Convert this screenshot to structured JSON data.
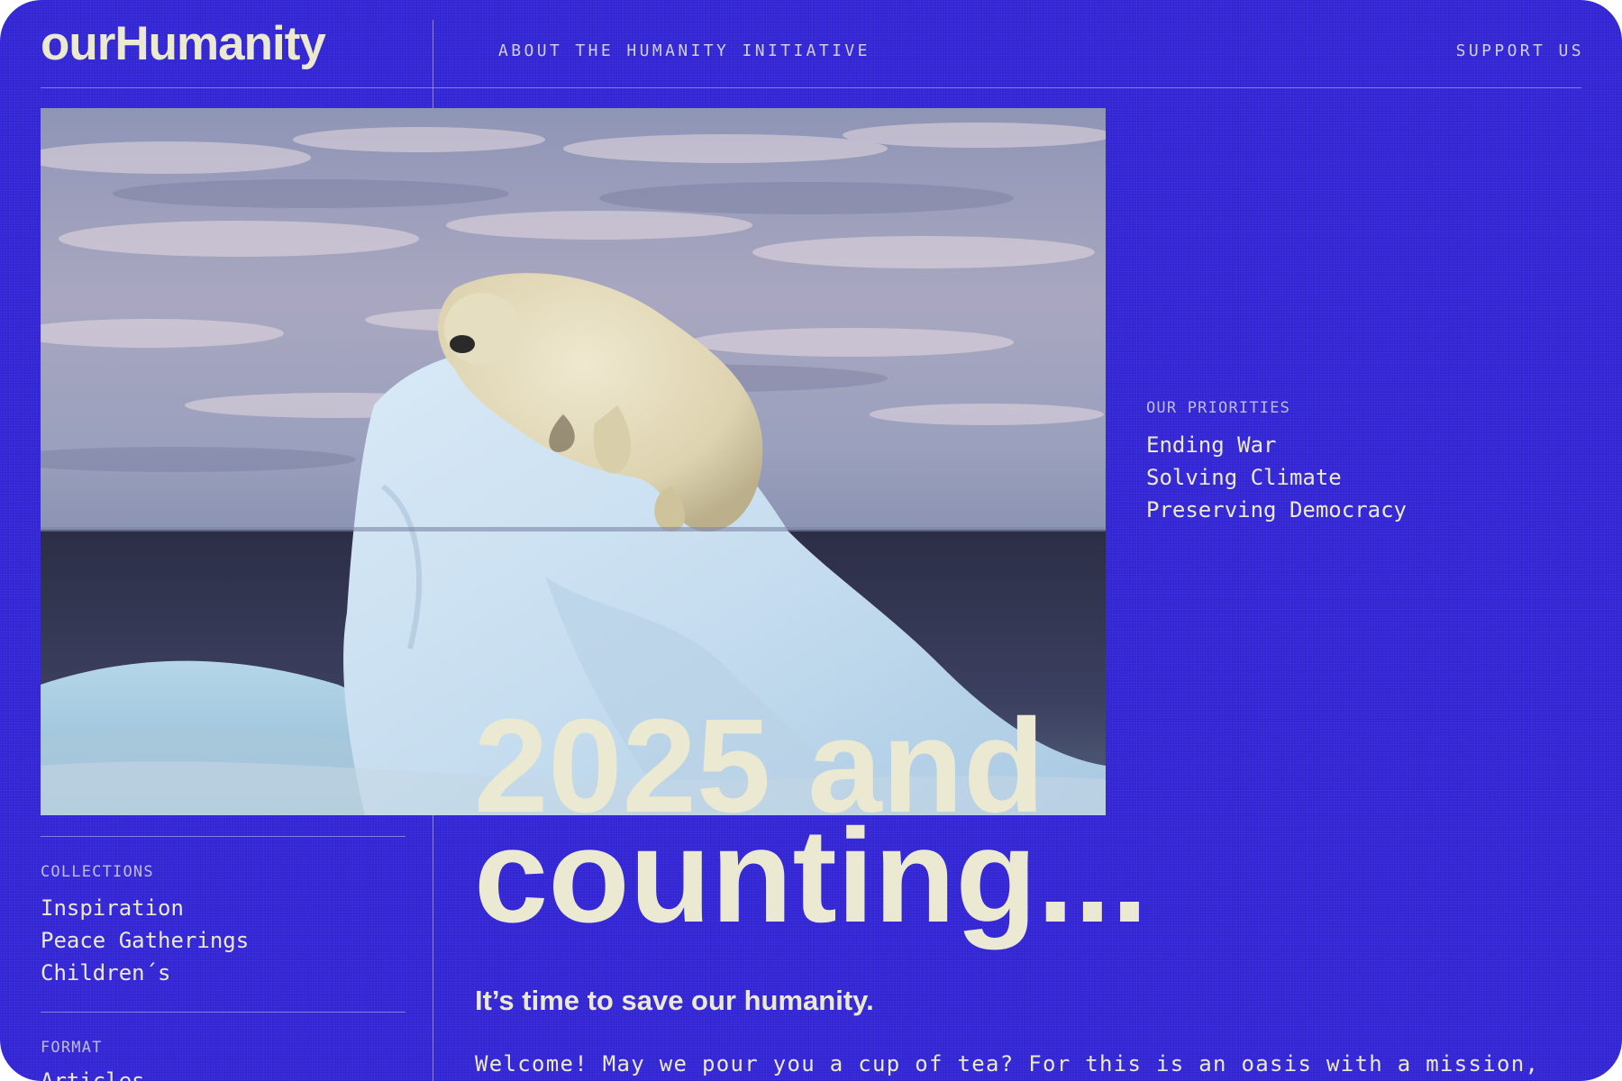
{
  "header": {
    "logo": "ourHumanity",
    "nav_about": "ABOUT THE HUMANITY INITIATIVE",
    "nav_support": "SUPPORT US"
  },
  "hero_image": {
    "subject": "polar bear sleeping on an iceberg at sea under a cloudy sky"
  },
  "priorities": {
    "label": "OUR PRIORITIES",
    "items": [
      "Ending War",
      "Solving Climate",
      "Preserving Democracy"
    ]
  },
  "collections": {
    "label": "COLLECTIONS",
    "items": [
      "Inspiration",
      "Peace Gatherings",
      "Children´s"
    ]
  },
  "format": {
    "label": "FORMAT",
    "items": [
      "Articles"
    ]
  },
  "main": {
    "headline_line1": "2025 and",
    "headline_line2": "counting...",
    "subheadline": "It’s time to save our humanity.",
    "intro": "Welcome! May we pour you a cup of tea? For this is an oasis with a mission,"
  },
  "colors": {
    "background": "#3326d6",
    "text": "#ece9d2",
    "muted": "#bfbbe6"
  }
}
